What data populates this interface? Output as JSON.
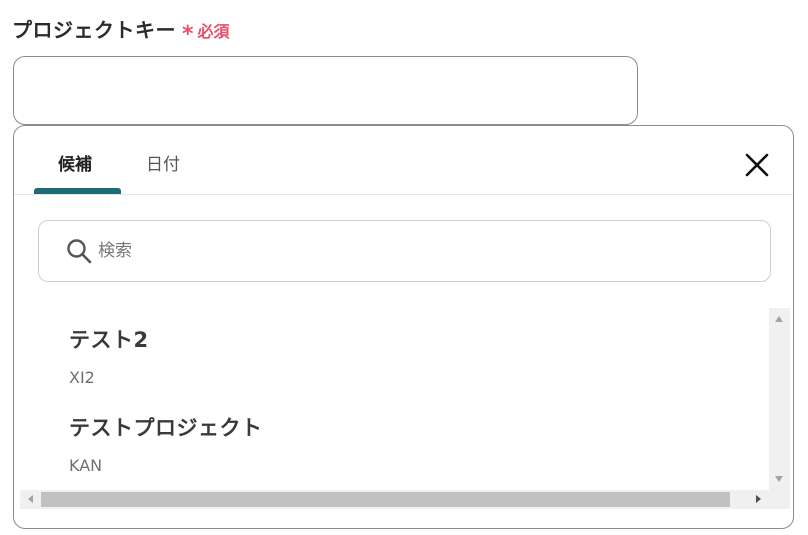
{
  "field": {
    "label": "プロジェクトキー",
    "asterisk": "*",
    "required": "必須",
    "value": ""
  },
  "popover": {
    "tabs": [
      {
        "label": "候補",
        "active": true
      },
      {
        "label": "日付",
        "active": false
      }
    ],
    "search_placeholder": "検索",
    "items": [
      {
        "title": "テスト2",
        "key": "XI2"
      },
      {
        "title": "テストプロジェクト",
        "key": "KAN"
      }
    ]
  },
  "colors": {
    "accent": "#1e6b78",
    "required": "#e8506b"
  },
  "icons": {
    "close": "close-icon",
    "search": "search-icon"
  }
}
